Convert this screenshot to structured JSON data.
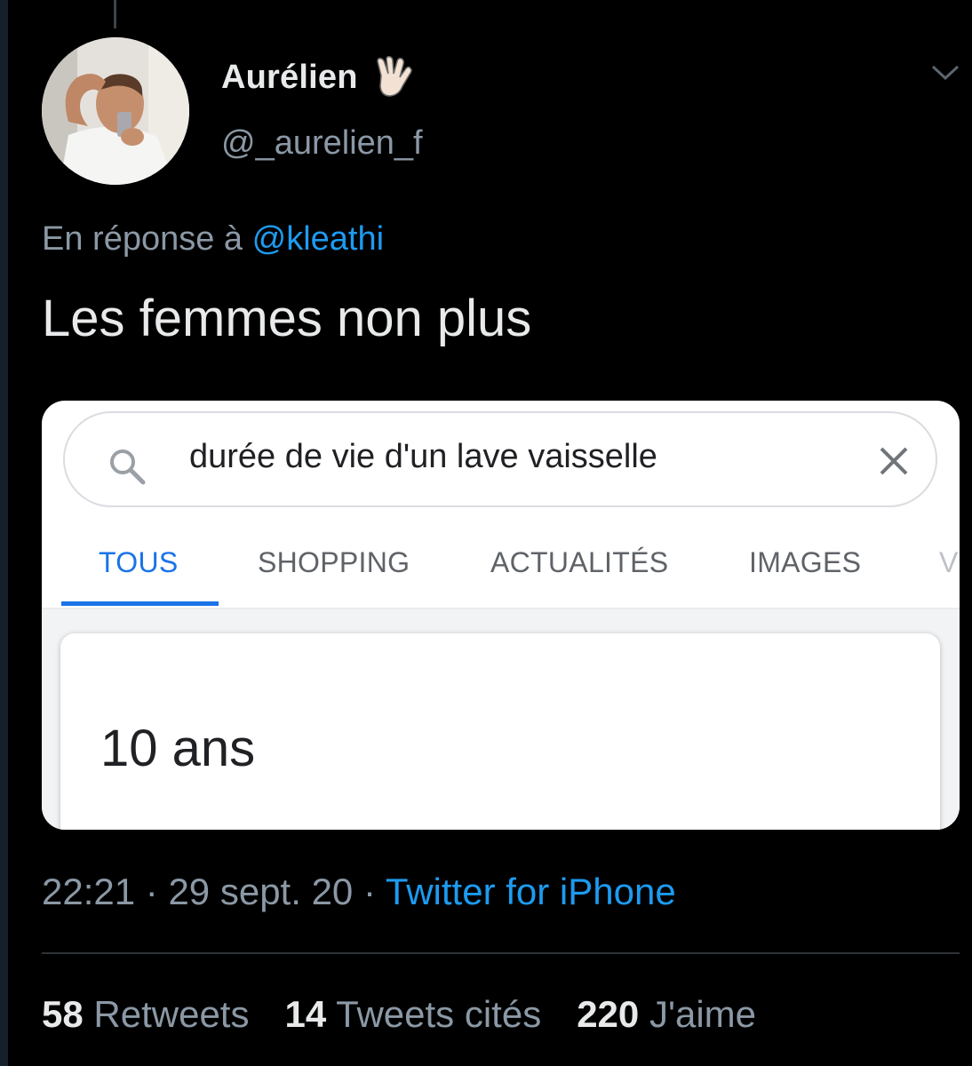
{
  "tweet": {
    "author": {
      "display_name": "Aurélien",
      "name_emoji": "raised-back-of-hand-vulcan-emoji",
      "handle": "@_aurelien_f"
    },
    "reply": {
      "prefix": "En réponse à",
      "mention": "@kleathi"
    },
    "text": "Les femmes non plus",
    "embedded_screenshot": {
      "search_query": "durée de vie d'un lave vaisselle",
      "tabs": [
        {
          "label": "TOUS",
          "active": true
        },
        {
          "label": "SHOPPING",
          "active": false
        },
        {
          "label": "ACTUALITÉS",
          "active": false
        },
        {
          "label": "IMAGES",
          "active": false
        },
        {
          "label": "V",
          "active": false
        }
      ],
      "answer": "10 ans"
    },
    "meta": {
      "time": "22:21",
      "date": "29 sept. 20",
      "separator": "·",
      "source": "Twitter for iPhone"
    },
    "stats": {
      "retweets": {
        "count": "58",
        "label": "Retweets"
      },
      "quotes": {
        "count": "14",
        "label": "Tweets cités"
      },
      "likes": {
        "count": "220",
        "label": "J'aime"
      }
    }
  },
  "colors": {
    "background": "#000000",
    "primary_text": "#e7e9ea",
    "secondary_text": "#8b98a5",
    "link": "#1d9bf0",
    "google_blue": "#1a73e8"
  }
}
